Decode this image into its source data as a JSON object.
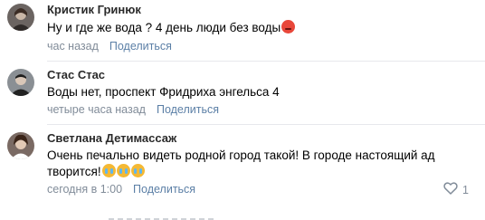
{
  "comments": [
    {
      "author": "Кристик Гринюк",
      "text": "Ну и где же вода ? 4 день люди без воды",
      "emoji": "angry-face-icon",
      "time": "час назад",
      "reply": "Поделиться"
    },
    {
      "author": "Стас Стас",
      "text": "Воды нет, проспект Фридриха энгельса 4",
      "time": "четыре часа назад",
      "reply": "Поделиться"
    },
    {
      "author": "Светлана Детимассаж",
      "text_line1": "Очень печально видеть родной город такой! В городе настоящий ад",
      "text_line2": "творится!",
      "emoji": "crying-face-icon",
      "time": "сегодня в 1:00",
      "reply": "Поделиться",
      "likes": "1"
    }
  ],
  "colors": {
    "link": "#5b7fa6",
    "meta": "#818c99",
    "divider": "#e7e8ec"
  }
}
